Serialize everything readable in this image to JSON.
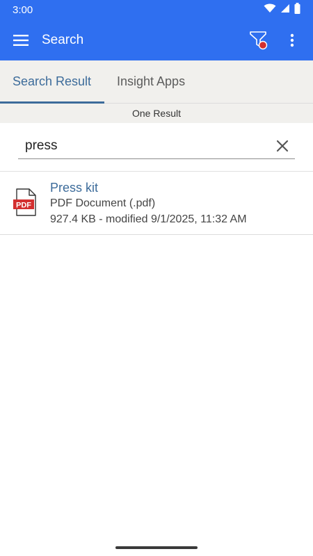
{
  "status_bar": {
    "time": "3:00",
    "icons": [
      "wifi-icon",
      "cell-signal-icon",
      "battery-icon"
    ]
  },
  "toolbar": {
    "title": "Search",
    "menu_icon": "hamburger-menu-icon",
    "filter_icon": "filter-funnel-icon",
    "overflow_icon": "more-vert-icon"
  },
  "tabs": [
    {
      "label": "Search Result",
      "active": true
    },
    {
      "label": "Insight Apps",
      "active": false
    }
  ],
  "result_count_label": "One Result",
  "search": {
    "value": "press",
    "clear_icon": "close-icon"
  },
  "results": [
    {
      "title": "Press kit",
      "type": "PDF Document (.pdf)",
      "meta": "927.4 KB - modified 9/1/2025, 11:32 AM",
      "icon": "pdf-file-icon",
      "icon_label": "PDF"
    }
  ],
  "colors": {
    "primary": "#2f6ff0",
    "accent_text": "#3c6b9a",
    "pdf_red": "#d32f2f",
    "filter_badge": "#d32f2f"
  }
}
